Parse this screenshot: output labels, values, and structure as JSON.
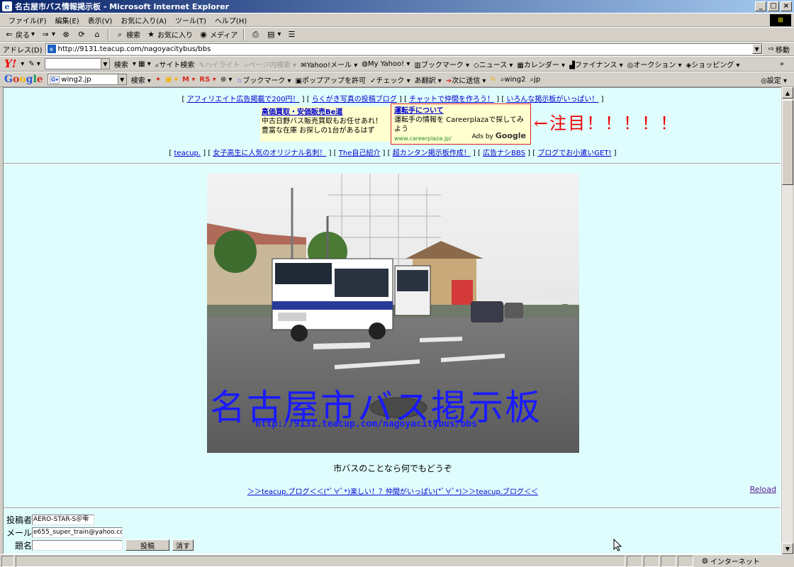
{
  "window": {
    "title": "名古屋市バス情報掲示板 - Microsoft Internet Explorer"
  },
  "menu": [
    "ファイル(F)",
    "編集(E)",
    "表示(V)",
    "お気に入り(A)",
    "ツール(T)",
    "ヘルプ(H)"
  ],
  "std_toolbar": {
    "back": "戻る",
    "search": "検索",
    "favorites": "お気に入り",
    "media": "メディア"
  },
  "address": {
    "label": "アドレス(D)",
    "url": "http://9131.teacup.com/nagoyacitybus/bbs",
    "go": "移動"
  },
  "yahoo_toolbar": {
    "logo": "Y!",
    "search": "検索",
    "site_search": "サイト検索",
    "highlight": "ハイライト",
    "page_search": "ページ内検索",
    "mail": "Yahoo!メール",
    "myyahoo": "My Yahoo!",
    "bookmark": "ブックマーク",
    "news": "ニュース",
    "calendar": "カレンダー",
    "finance": "ファイナンス",
    "auction": "オークション",
    "shopping": "ショッピング"
  },
  "google_toolbar": {
    "search_value": "wing2.jp",
    "search": "検索",
    "rs": "RS",
    "bookmark": "ブックマーク",
    "popup": "ポップアップを許可",
    "check": "チェック",
    "translate": "翻訳",
    "next": "次に送信",
    "wing2": "wing2",
    "jp": "jp",
    "settings": "設定"
  },
  "content": {
    "top_links": [
      "アフィリエイト広告掲載で200円！",
      "らくがき写真の投稿ブログ",
      "チャットで仲間を作ろう！",
      "いろんな掲示板がいっぱい！"
    ],
    "ad_left": {
      "headline": "高価買取・安価販売Be道",
      "body": "中古日野バス販売買取もお任せあれ！ 豊富な在庫 お探しの1台があるはず"
    },
    "ad_right": {
      "headline": "運転手について",
      "body": "運転手の情報を Careerplazaで探してみよう",
      "url": "www.careerplaza.jp/",
      "ads_by": "Ads by",
      "google": "Google"
    },
    "notice": "←注目！！！！！",
    "bottom_links": [
      "teacup.",
      "女子高生に人気のオリジナル名刺！",
      "The自己紹介",
      "超カンタン掲示板作成！",
      "広告ナシBBS",
      "ブログでお小遣いGET!"
    ],
    "photo_title": "名古屋市バス掲示板",
    "photo_url": "http://9131.teacup.com/nagoyacitybus/bbs",
    "tagline": "市バスのことなら何でもどうぞ",
    "profile_link": "＞＞teacup.ブログ＜＜(*ﾟ∀ﾟ*)楽しい！？仲間がいっぱい(*ﾟ∀ﾟ*)＞＞teacup.ブログ＜＜",
    "reload": "Reload"
  },
  "form": {
    "author_label": "投稿者",
    "author_value": "AERO-STAR-S＠雫",
    "mail_label": "メール",
    "mail_value": "e655_super_train@yahoo.co.jp",
    "subject_label": "題名",
    "subject_value": "",
    "submit": "投稿",
    "clear": "消す"
  },
  "status": {
    "zone": "インターネット"
  }
}
